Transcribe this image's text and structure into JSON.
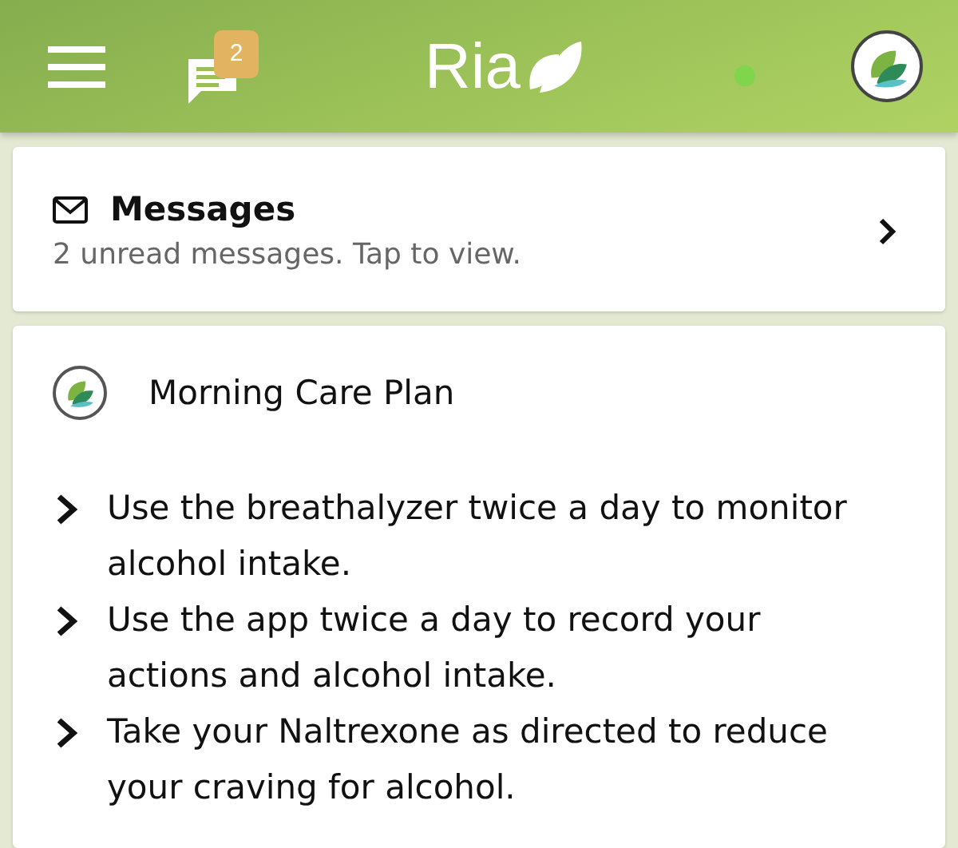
{
  "header": {
    "logo": "Ria",
    "messages_badge": "2"
  },
  "messages_card": {
    "title": "Messages",
    "subtitle": "2 unread messages. Tap to view."
  },
  "care_plan": {
    "title": "Morning Care Plan",
    "items": [
      "Use the breathalyzer twice a day to monitor alcohol intake.",
      "Use the app twice a day to record your actions and alcohol intake.",
      "Take your Naltrexone as directed to reduce your craving for alcohol."
    ]
  }
}
